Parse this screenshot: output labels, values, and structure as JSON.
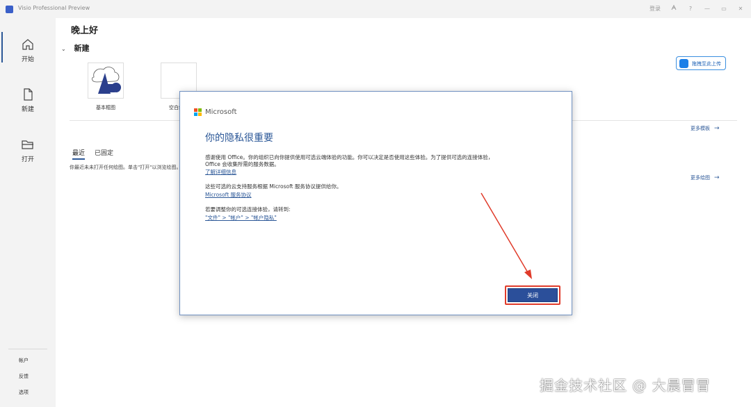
{
  "titlebar": {
    "app_title": "Visio Professional Preview",
    "login_label": "登录",
    "help_label": "?",
    "min_label": "—",
    "restore_label": "▭",
    "close_label": "✕"
  },
  "leftnav": {
    "items": [
      {
        "label": "开始",
        "icon": "home-icon"
      },
      {
        "label": "新建",
        "icon": "new-document-icon"
      },
      {
        "label": "打开",
        "icon": "folder-open-icon"
      }
    ],
    "bottom": [
      {
        "label": "帐户"
      },
      {
        "label": "反馈"
      },
      {
        "label": "选项"
      }
    ]
  },
  "main": {
    "greeting": "晚上好",
    "new_section": "新建",
    "templates": [
      {
        "label": "基本框图"
      },
      {
        "label": "空白绘图"
      }
    ],
    "upload_button": "拖拽至此上传",
    "more_templates": "更多模板",
    "more_drawings": "更多绘图",
    "tabs": [
      "最近",
      "已固定"
    ],
    "empty_text": "你最近未未打开任何绘图。单击\"打开\"以浏览绘图。"
  },
  "dialog": {
    "brand": "Microsoft",
    "title": "你的隐私很重要",
    "para1_line1": "感谢使用 Office。你的组织已向你提供使用可选云端体验的功能。你可以决定是否使用这些体验。为了提供可选的连接体验，",
    "para1_line2": "Office 会收集所需的服务数据。",
    "link1": "了解详细信息",
    "para2": "这些可选的云支持服务根据 Microsoft 服务协议提供给你。",
    "link2": "Microsoft 服务协议",
    "para3": "若要调整你的可选连接体验，请转到:",
    "link3": "\"文件\" > \"帐户\" > \"帐户隐私\"",
    "close_button": "关闭"
  },
  "watermark": "掘金技术社区 @ 大晨冒冒",
  "colors": {
    "accent": "#2b5797",
    "annotation": "#e03b2a",
    "nav_bg": "#f3f3f3"
  }
}
